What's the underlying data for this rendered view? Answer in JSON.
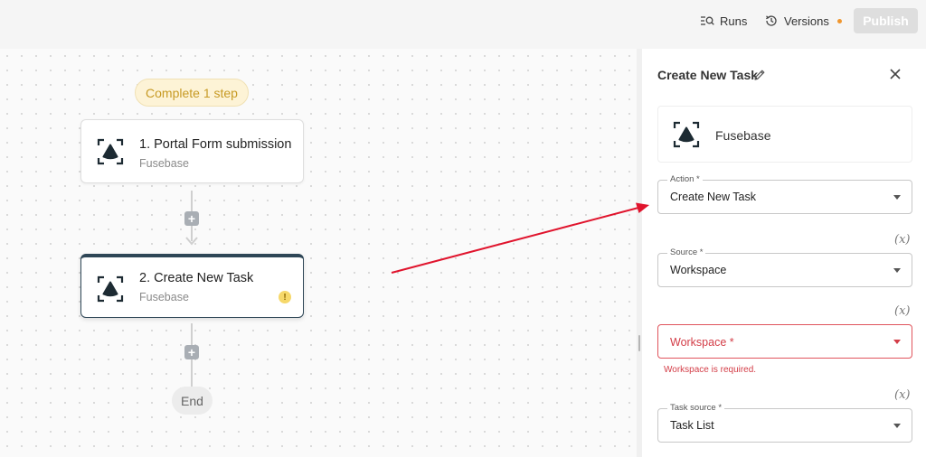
{
  "header": {
    "runs_label": "Runs",
    "versions_label": "Versions",
    "publish_label": "Publish"
  },
  "canvas": {
    "status_pill": "Complete 1 step",
    "nodes": [
      {
        "title": "1. Portal Form submission",
        "subtitle": "Fusebase"
      },
      {
        "title": "2. Create New Task",
        "subtitle": "Fusebase",
        "warning": "!"
      }
    ],
    "end_label": "End",
    "add_symbol": "+"
  },
  "panel": {
    "title": "Create New Task",
    "app_name": "Fusebase",
    "fields": {
      "action": {
        "label": "Action *",
        "value": "Create New Task"
      },
      "source": {
        "label": "Source *",
        "value": "Workspace"
      },
      "workspace": {
        "placeholder": "Workspace *",
        "error": "Workspace is required."
      },
      "task_source": {
        "label": "Task source *",
        "value": "Task List"
      }
    },
    "var_symbol": "(x)"
  },
  "colors": {
    "accent_dark": "#2e4656",
    "error": "#d33d47",
    "pill_text": "#c79a24",
    "arrow": "#e0142d"
  }
}
